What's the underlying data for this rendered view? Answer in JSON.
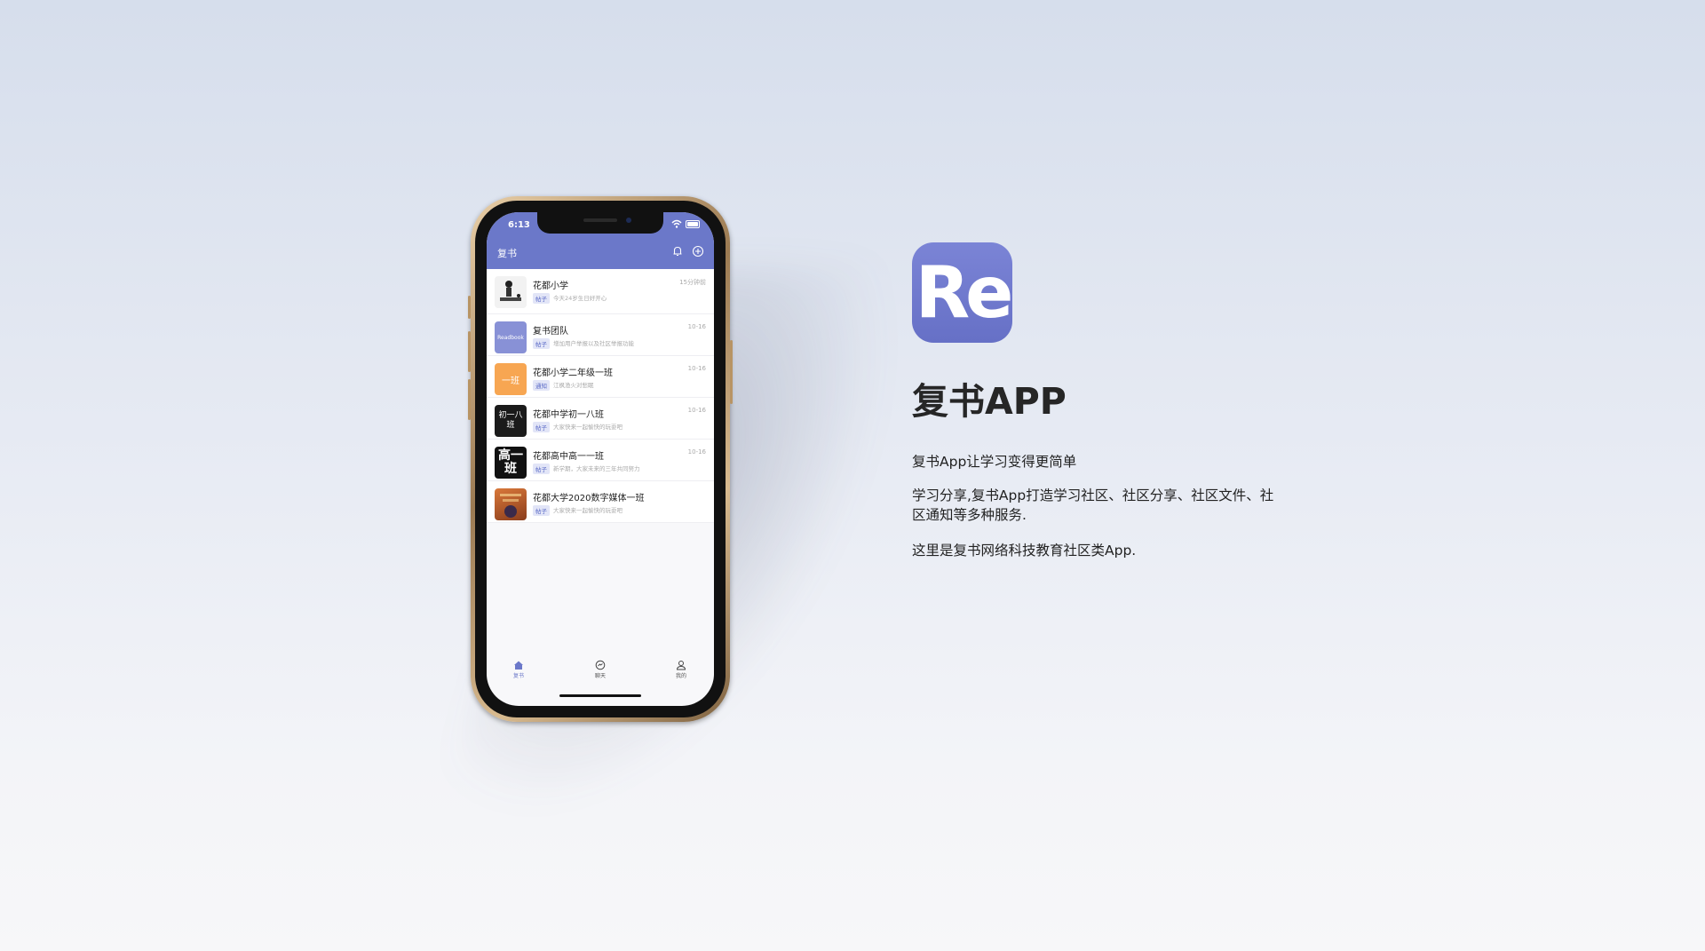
{
  "status_bar": {
    "time": "6:13"
  },
  "app": {
    "title": "复书"
  },
  "list": [
    {
      "name": "花都小学",
      "time": "15分钟前",
      "tag": "帖子",
      "preview": "今天24岁生日好开心",
      "avatar_color": "#f2f2f2"
    },
    {
      "name": "复书团队",
      "time": "10-16",
      "tag": "帖子",
      "preview": "增加用户举报以及社区举报功能",
      "avatar_color": "#8891d6"
    },
    {
      "name": "花都小学二年级一班",
      "time": "10-16",
      "tag": "通知",
      "preview": "江枫渔火对愁眠",
      "avatar_color": "#f7a652"
    },
    {
      "name": "花都中学初一八班",
      "time": "10-16",
      "tag": "帖子",
      "preview": "大家快来一起愉快的玩耍吧",
      "avatar_color": "#1a1a1a"
    },
    {
      "name": "花都高中高一一班",
      "time": "10-16",
      "tag": "帖子",
      "preview": "新学期，大家未来的三年共同努力",
      "avatar_color": "#111111"
    },
    {
      "name": "花都大学2020数字媒体一班",
      "time": "",
      "tag": "帖子",
      "preview": "大家快来一起愉快的玩耍吧",
      "avatar_color": "#c8652a"
    }
  ],
  "avatar_texts": {
    "team": "Readbook",
    "class2": "一班",
    "middle": "初一八班",
    "high": "高一班"
  },
  "tabs": [
    {
      "label": "复书",
      "icon": "home-icon",
      "active": true
    },
    {
      "label": "聊天",
      "icon": "chat-icon",
      "active": false
    },
    {
      "label": "我的",
      "icon": "profile-icon",
      "active": false
    }
  ],
  "logo": {
    "text": "Re"
  },
  "brand": {
    "title": "复书APP",
    "line1": "复书App让学习变得更简单",
    "line2": "学习分享,复书App打造学习社区、社区分享、社区文件、社区通知等多种服务.",
    "line3": "这里是复书网络科技教育社区类App."
  },
  "colors": {
    "accent": "#6b78c9",
    "logo": "#6f79cd"
  }
}
